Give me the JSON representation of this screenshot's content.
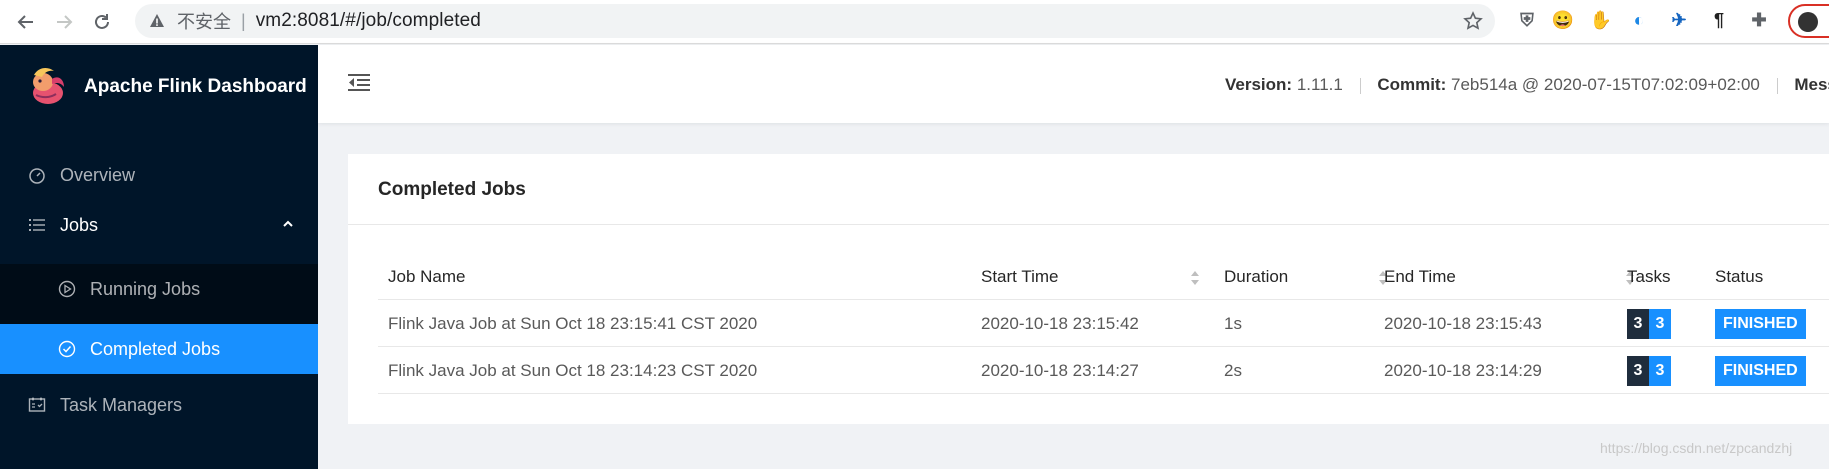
{
  "browser": {
    "security_label": "不安全",
    "separator": "|",
    "url": "vm2:8081/#/job/completed",
    "extensions": [
      {
        "name": "shield-ext",
        "color": "#5f6368",
        "glyph": "⛨"
      },
      {
        "name": "orange-ext",
        "color": "#f57c00",
        "glyph": "😀"
      },
      {
        "name": "adblock-ext",
        "color": "#e53935",
        "glyph": "✋"
      },
      {
        "name": "edge-ext",
        "color": "#1e88e5",
        "glyph": "◐"
      },
      {
        "name": "bird-ext",
        "color": "#1565c0",
        "glyph": "✈"
      },
      {
        "name": "pilcrow-ext",
        "color": "#212121",
        "glyph": "¶"
      },
      {
        "name": "puzzle-ext",
        "color": "#5f6368",
        "glyph": "✚"
      }
    ]
  },
  "sidebar": {
    "brand": "Apache Flink Dashboard",
    "items": [
      {
        "label": "Overview"
      },
      {
        "label": "Jobs"
      },
      {
        "label": "Running Jobs"
      },
      {
        "label": "Completed Jobs"
      },
      {
        "label": "Task Managers"
      }
    ]
  },
  "header": {
    "version_label": "Version:",
    "version_value": "1.11.1",
    "commit_label": "Commit:",
    "commit_value": "7eb514a @ 2020-07-15T07:02:09+02:00",
    "message_label": "Message"
  },
  "card": {
    "title": "Completed Jobs",
    "columns": [
      "Job Name",
      "Start Time",
      "Duration",
      "End Time",
      "Tasks",
      "Status"
    ],
    "rows": [
      {
        "name": "Flink Java Job at Sun Oct 18 23:15:41 CST 2020",
        "start": "2020-10-18 23:15:42",
        "duration": "1s",
        "end": "2020-10-18 23:15:43",
        "tasks_a": "3",
        "tasks_b": "3",
        "status": "FINISHED"
      },
      {
        "name": "Flink Java Job at Sun Oct 18 23:14:23 CST 2020",
        "start": "2020-10-18 23:14:27",
        "duration": "2s",
        "end": "2020-10-18 23:14:29",
        "tasks_a": "3",
        "tasks_b": "3",
        "status": "FINISHED"
      }
    ]
  },
  "colors": {
    "sidebar_bg": "#001529",
    "active": "#1890ff",
    "task_dark": "#1f2d3d",
    "task_blue": "#1890ff",
    "finished": "#1890ff"
  },
  "watermark": "https://blog.csdn.net/zpcandzhj"
}
